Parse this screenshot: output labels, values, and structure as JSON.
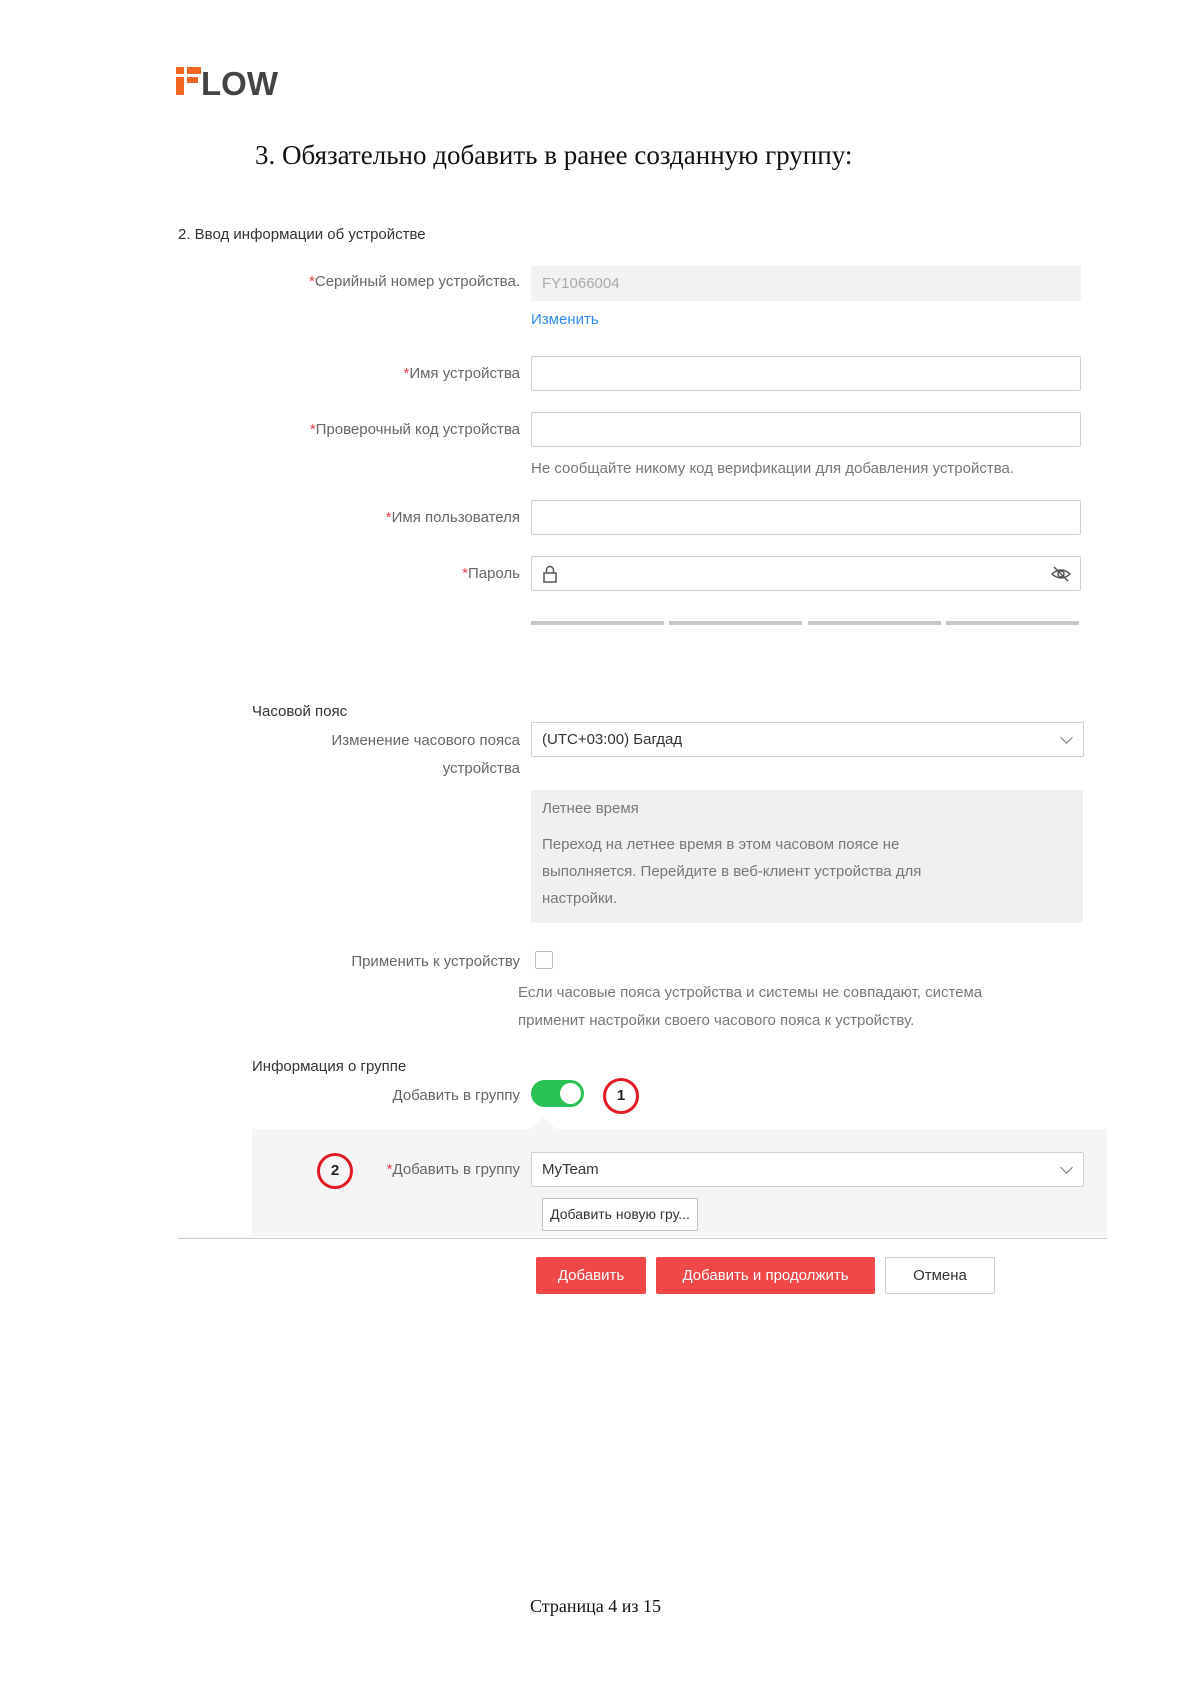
{
  "logo": {
    "text": "FLOW",
    "accent": "#f26522",
    "color": "#444444"
  },
  "heading": "3. Обязательно добавить в ранее созданную группу:",
  "section_title": "2. Ввод информации об устройстве",
  "fields": {
    "serial": {
      "label": "Серийный номер устройства.",
      "value": "FY1066004",
      "link": "Изменить"
    },
    "device_name": {
      "label": "Имя устройства",
      "value": ""
    },
    "verify_code": {
      "label": "Проверочный код устройства",
      "value": "",
      "hint": "Не сообщайте никому код верификации для добавления устройства."
    },
    "username": {
      "label": "Имя пользователя",
      "value": ""
    },
    "password": {
      "label": "Пароль",
      "value": "",
      "lock_icon": "lock-icon",
      "eye_icon": "eye-off-icon"
    }
  },
  "timezone": {
    "heading": "Часовой пояс",
    "label_line1": "Изменение часового пояса",
    "label_line2": "устройства",
    "value": "(UTC+03:00) Багдад",
    "dst_title": "Летнее время",
    "dst_text": "Переход на летнее время в этом часовом поясе не выполняется. Перейдите в веб-клиент устройства для настройки.",
    "apply_label": "Применить к устройству",
    "apply_checked": false,
    "apply_hint": "Если часовые пояса устройства и системы не совпадают, система применит настройки своего часового пояса к устройству."
  },
  "group": {
    "heading": "Информация о группе",
    "toggle_label": "Добавить в группу",
    "toggle_on": true,
    "select_label": "Добавить в группу",
    "select_value": "MyTeam",
    "new_group_button": "Добавить новую гру..."
  },
  "markers": {
    "one": "1",
    "two": "2"
  },
  "buttons": {
    "add": "Добавить",
    "add_continue": "Добавить и продолжить",
    "cancel": "Отмена"
  },
  "footer": "Страница 4 из 15",
  "colors": {
    "accent_red": "#f04848",
    "link_blue": "#2d8cf0",
    "toggle_green": "#2ac254",
    "marker_red": "#e01b24"
  }
}
